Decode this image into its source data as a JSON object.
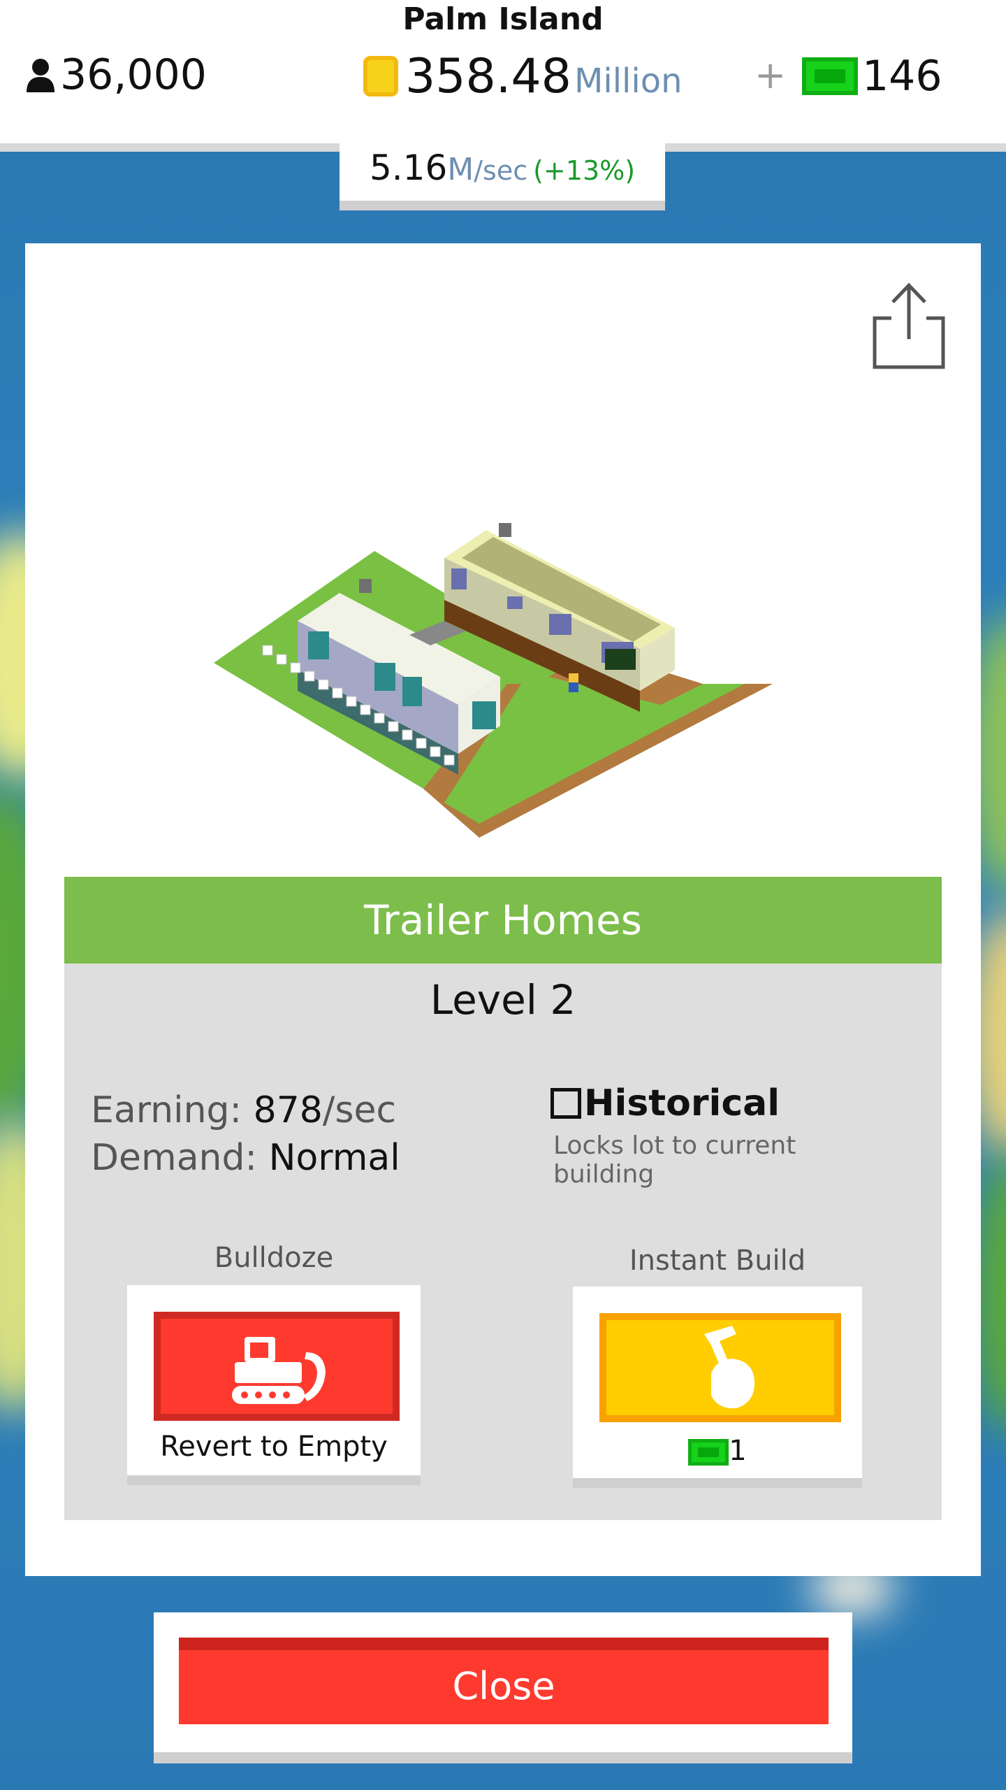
{
  "header": {
    "city_name": "Palm Island",
    "population": "36,000",
    "coins_value": "358.48",
    "coins_unit": "Million",
    "plus_label": "+",
    "bills_value": "146",
    "rate_value": "5.16",
    "rate_unit": "M",
    "rate_suffix": "/sec",
    "rate_change": "(+13%)"
  },
  "building": {
    "name": "Trailer Homes",
    "level": "Level 2",
    "earning_label": "Earning:",
    "earning_value": "878",
    "earning_suffix": "/sec",
    "demand_label": "Demand:",
    "demand_value": "Normal",
    "historical_label": "Historical",
    "historical_desc": "Locks lot to current building"
  },
  "actions": {
    "bulldoze_label": "Bulldoze",
    "bulldoze_button_text": "Revert to Empty",
    "instant_label": "Instant Build",
    "instant_cost": "1"
  },
  "footer": {
    "close_label": "Close"
  },
  "icons": {
    "population": "person-icon",
    "coins": "coin-icon",
    "bills": "cash-icon",
    "share": "share-icon",
    "bulldoze": "bulldozer-icon",
    "instant": "hammer-hand-icon"
  },
  "colors": {
    "title_green": "#7cbd4b",
    "danger_red": "#fe3a2f",
    "gold": "#ffcd00",
    "cash_green": "#16d21a"
  }
}
